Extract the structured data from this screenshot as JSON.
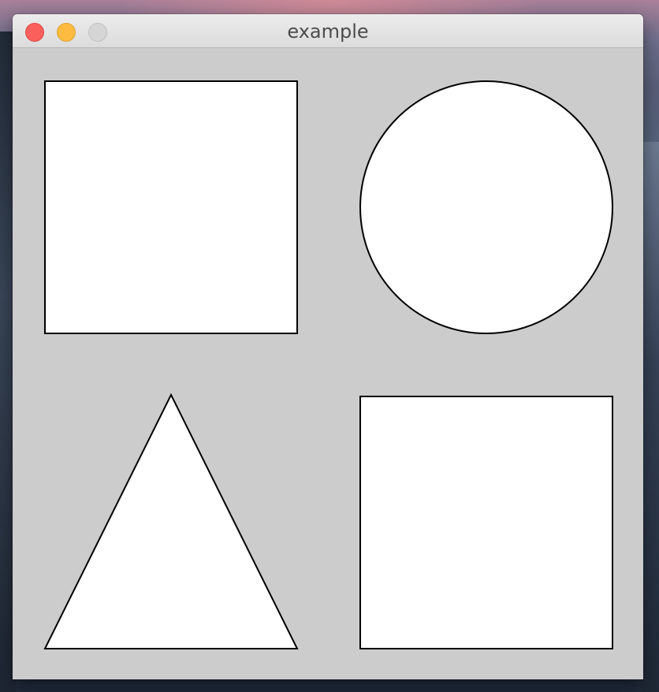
{
  "window": {
    "title": "example",
    "controls": [
      "close",
      "minimize",
      "zoom"
    ]
  },
  "canvas": {
    "background": "#cccccc",
    "shapes": [
      "square",
      "circle",
      "triangle",
      "square"
    ],
    "fill_color": "#ffffff",
    "stroke_color": "#000000"
  }
}
